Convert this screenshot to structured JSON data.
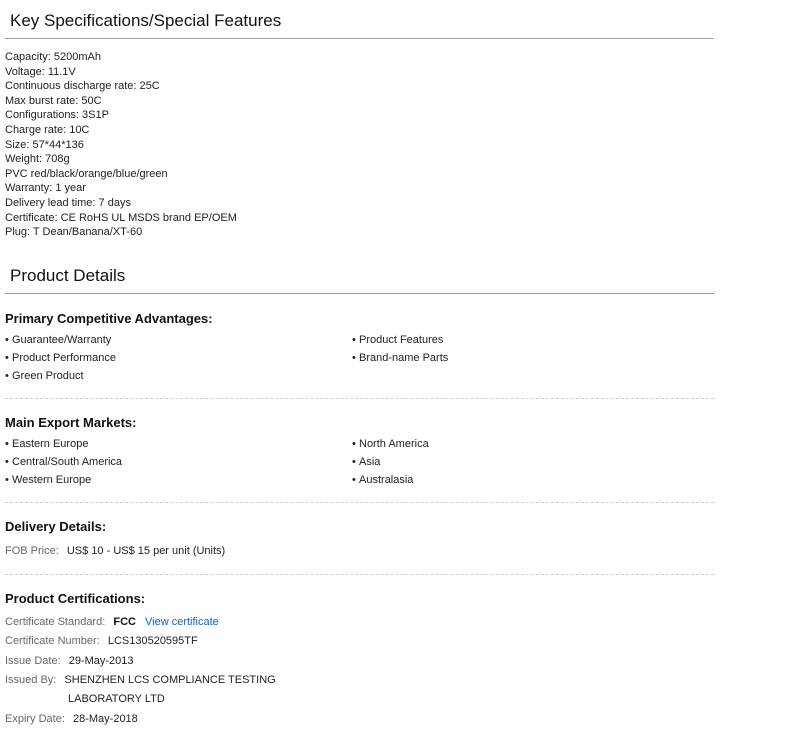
{
  "key_specs": {
    "title": "Key Specifications/Special Features",
    "items": [
      "Capacity: 5200mAh",
      "Voltage: 11.1V",
      "Continuous discharge rate: 25C",
      "Max burst rate: 50C",
      "Configurations: 3S1P",
      "Charge rate: 10C",
      "Size: 57*44*136",
      "Weight: 708g",
      "PVC red/black/orange/blue/green",
      "Warranty: 1 year",
      "Delivery lead time: 7 days",
      "Certificate: CE RoHS UL MSDS brand EP/OEM",
      "Plug: T Dean/Banana/XT-60"
    ]
  },
  "product_details": {
    "title": "Product Details",
    "advantages": {
      "title": "Primary Competitive Advantages:",
      "bullet": "•",
      "items": [
        "Guarantee/Warranty",
        "Product Features",
        "Product Performance",
        "Brand-name Parts",
        "Green Product"
      ]
    },
    "markets": {
      "title": "Main Export Markets:",
      "bullet": "•",
      "items": [
        "Eastern Europe",
        "North America",
        "Central/South America",
        "Asia",
        "Western Europe",
        "Australasia"
      ]
    },
    "delivery": {
      "title": "Delivery Details:",
      "fob_label": "FOB Price:",
      "fob_value": "US$ 10 - US$ 15 per unit (Units)"
    },
    "certifications": {
      "title": "Product Certifications:",
      "standard_label": "Certificate Standard:",
      "standard_value": "FCC",
      "view_link": "View certificate",
      "number_label": "Certificate Number:",
      "number_value": "LCS130520595TF",
      "issue_label": "Issue Date:",
      "issue_value": "29-May-2013",
      "issued_by_label": "Issued By:",
      "issued_by_line1": "SHENZHEN LCS COMPLIANCE TESTING",
      "issued_by_line2": "LABORATORY LTD",
      "expiry_label": "Expiry Date:",
      "expiry_value": "28-May-2018"
    }
  }
}
